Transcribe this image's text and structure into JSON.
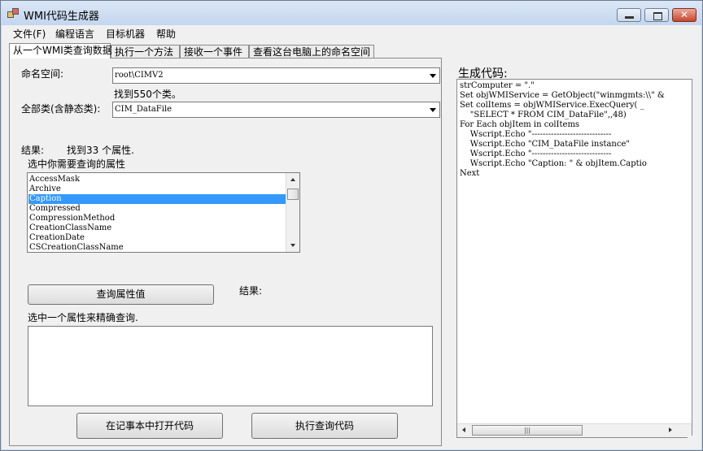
{
  "window": {
    "title": "WMI代码生成器"
  },
  "menu": [
    "文件(F)",
    "编程语言",
    "目标机器",
    "帮助"
  ],
  "tabs": [
    "从一个WMI类查询数据",
    "执行一个方法",
    "接收一个事件",
    "查看这台电脑上的命名空间"
  ],
  "query": {
    "namespace_label": "命名空间:",
    "namespace_value": "root\\CIMV2",
    "found_classes": "找到550个类。",
    "classes_label": "全部类(含静态类):",
    "class_value": "CIM_DataFile",
    "results_label": "结果:",
    "found_props": "找到33 个属性.",
    "select_props_label": "选中你需要查询的属性",
    "properties": [
      "AccessMask",
      "Archive",
      "Caption",
      "Compressed",
      "CompressionMethod",
      "CreationClassName",
      "CreationDate",
      "CSCreationClassName"
    ],
    "selected_property": "Caption",
    "query_button": "查询属性值",
    "results2_label": "结果:",
    "precise_label": "选中一个属性来精确查询.",
    "open_notepad_button": "在记事本中打开代码",
    "run_button": "执行查询代码"
  },
  "code": {
    "label": "生成代码:",
    "lines": [
      "strComputer = \".\"",
      "Set objWMIService = GetObject(\"winmgmts:\\\\\" &",
      "Set colItems = objWMIService.ExecQuery( _",
      "    \"SELECT * FROM CIM_DataFile\",,48)",
      "For Each objItem in colItems",
      "    Wscript.Echo \"-----------------------------",
      "    Wscript.Echo \"CIM_DataFile instance\"",
      "    Wscript.Echo \"-----------------------------",
      "    Wscript.Echo \"Caption: \" & objItem.Captio",
      "Next"
    ],
    "scroll_thumb_glyph": "|||"
  }
}
